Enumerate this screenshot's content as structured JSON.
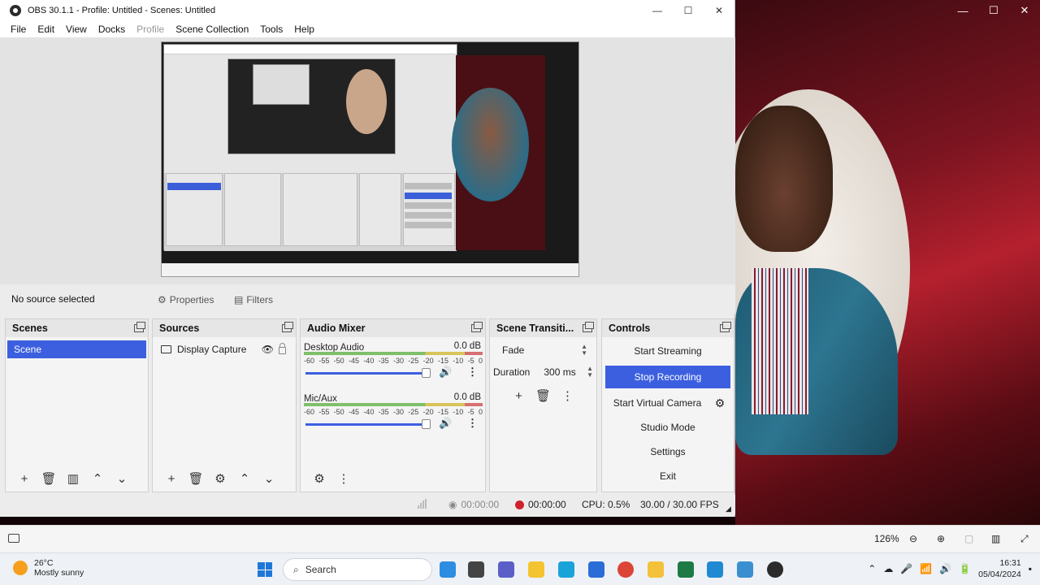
{
  "window": {
    "title": "OBS 30.1.1 - Profile: Untitled - Scenes: Untitled",
    "minimize": "—",
    "maximize": "☐",
    "close": "✕"
  },
  "menu": [
    "File",
    "Edit",
    "View",
    "Docks",
    "Profile",
    "Scene Collection",
    "Tools",
    "Help"
  ],
  "source_bar": {
    "no_source": "No source selected",
    "properties": "Properties",
    "filters": "Filters"
  },
  "scenes": {
    "title": "Scenes",
    "items": [
      "Scene"
    ]
  },
  "sources": {
    "title": "Sources",
    "items": [
      "Display Capture"
    ]
  },
  "mixer": {
    "title": "Audio Mixer",
    "channels": [
      {
        "name": "Desktop Audio",
        "level": "0.0 dB",
        "volume": 0.94
      },
      {
        "name": "Mic/Aux",
        "level": "0.0 dB",
        "volume": 0.94
      }
    ],
    "ticks": [
      "-60",
      "-55",
      "-50",
      "-45",
      "-40",
      "-35",
      "-30",
      "-25",
      "-20",
      "-15",
      "-10",
      "-5",
      "0"
    ]
  },
  "transitions": {
    "title": "Scene Transiti...",
    "selected": "Fade",
    "duration_label": "Duration",
    "duration_value": "300 ms"
  },
  "controls": {
    "title": "Controls",
    "start_streaming": "Start Streaming",
    "stop_recording": "Stop Recording",
    "start_virtual_camera": "Start Virtual Camera",
    "studio_mode": "Studio Mode",
    "settings": "Settings",
    "exit": "Exit"
  },
  "status": {
    "stream_time": "00:00:00",
    "rec_time": "00:00:00",
    "cpu": "CPU: 0.5%",
    "fps": "30.00 / 30.00 FPS"
  },
  "host": {
    "zoom": "126%"
  },
  "taskbar": {
    "temperature": "26°C",
    "weather": "Mostly sunny",
    "search": "Search",
    "time": "16:31",
    "date": "05/04/2024"
  },
  "colors": {
    "accent": "#3c5fe0",
    "record": "#d0212c"
  }
}
